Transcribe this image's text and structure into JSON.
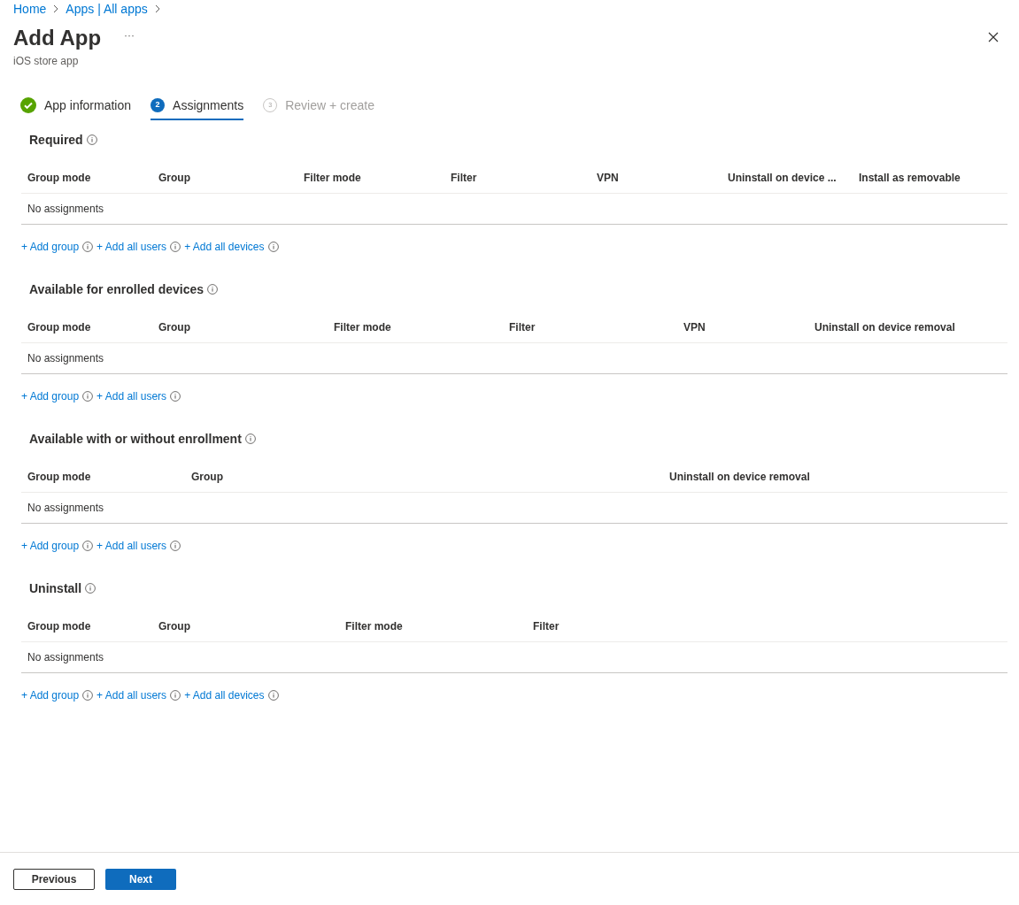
{
  "breadcrumb": [
    "Home",
    "Apps | All apps"
  ],
  "title": "Add App",
  "more": "···",
  "subtitle": "iOS store app",
  "steps": [
    {
      "label": "App information",
      "kind": "done",
      "selected": false
    },
    {
      "label": "Assignments",
      "kind": "numbered",
      "number": "2",
      "selected": true
    },
    {
      "label": "Review + create",
      "kind": "numbered",
      "number": "3",
      "selected": false
    }
  ],
  "sections": [
    {
      "title": "Required",
      "columns": [
        "Group mode",
        "Group",
        "Filter mode",
        "Filter",
        "VPN",
        "Uninstall on device ...",
        "Install as removable"
      ],
      "empty": "No assignments",
      "links": [
        "+ Add group",
        "+ Add all users",
        "+ Add all devices"
      ]
    },
    {
      "title": "Available for enrolled devices",
      "columns": [
        "Group mode",
        "Group",
        "Filter mode",
        "Filter",
        "VPN",
        "Uninstall on device removal"
      ],
      "empty": "No assignments",
      "links": [
        "+ Add group",
        "+ Add all users"
      ]
    },
    {
      "title": "Available with or without enrollment",
      "columns": [
        "Group mode",
        "Group",
        "Uninstall on device removal"
      ],
      "empty": "No assignments",
      "links": [
        "+ Add group",
        "+ Add all users"
      ]
    },
    {
      "title": "Uninstall",
      "columns": [
        "Group mode",
        "Group",
        "Filter mode",
        "Filter"
      ],
      "empty": "No assignments",
      "links": [
        "+ Add group",
        "+ Add all users",
        "+ Add all devices"
      ]
    }
  ],
  "buttons": [
    {
      "label": "Previous",
      "kind": "secondary"
    },
    {
      "label": "Next",
      "kind": "primary"
    }
  ]
}
